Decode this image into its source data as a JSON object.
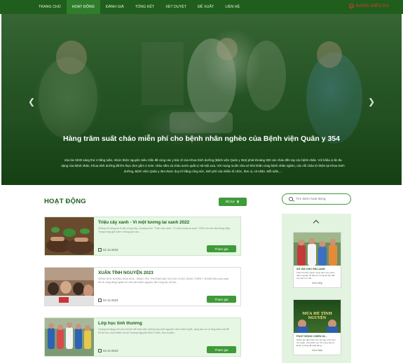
{
  "nav": {
    "items": [
      "TRANG CHỦ",
      "HOẠT ĐỘNG",
      "ĐÁNH GIÁ",
      "TỔNG KẾT",
      "XÉT DUYỆT",
      "ĐỀ XUẤT",
      "LIÊN HỆ"
    ],
    "active_index": 1,
    "live_label": "ĐANG DIỄN RA",
    "live_color": "#e0392b"
  },
  "hero": {
    "title": "Hàng trăm suất cháo miễn phí cho bệnh nhân nghèo của Bệnh viện Quân y 354",
    "description": "Vào lúc 5h30 sáng thứ 4 hằng tuần, nhóm thiện nguyện Siêu Gần đã cùng các y bác sĩ của Khoa Dinh dưỡng (Bệnh viện Quân y 354) phát khoảng 300 các cháo đến tay các bệnh nhân. Với khẩu vị ăn đa dạng của bệnh nhân, Khoa dinh dưỡng đã lên thực đơn gồm 2 món: cháo nấm và cháo sườn quất vị Hà Nội xưa. Với mong muốn chia sẻ khó khăn cùng bệnh nhân nghèo, các nồi cháo từ thiện tại Khoa Dinh dưỡng, Bệnh viện Quân y 354 được duy trì bằng công sức, kinh phí của nhiều tổ chức, đơn vị, cá nhân. Mỗi tuần,...",
    "prev_icon": "chevron-left-icon",
    "next_icon": "chevron-right-icon"
  },
  "section": {
    "title": "HOẠT ĐỘNG",
    "filter_label": "Bộ lọc",
    "filter_icon": "filter-icon"
  },
  "search": {
    "placeholder": "Tìm kiếm hoạt động"
  },
  "activities": [
    {
      "title": "Triệu cây xanh - Vì một tương lai xanh 2022",
      "excerpt": "Không chỉ dừng lại ở việc trồng cây, chương trình \"Triệu cây xanh - Vì một tương lai xanh\" 2022 còn lan tỏa thông điệp \"trồng rừng giữ nước\" thông qua các...",
      "date": "01-12-2023",
      "join_label": "Tham gia",
      "highlighted": true
    },
    {
      "title": "XUÂN TÌNH NGUYỆN 2023",
      "excerpt": "SỐNG NHƯ NHỮNG ĐÓA HOA - HĂNG YÊU THƯƠNG BAY XA CHO CUỘC SỐNG THÊM Ý NGHĨA Mỗi mùa xuân tết về cũng đồng nghĩa với việc làm thiện nguyện, Bộ Công tác Xã hội...",
      "date": "04-12-2023",
      "join_label": "Tham gia",
      "highlighted": false
    },
    {
      "title": "Lớp học tình thương",
      "excerpt": "Chúng tôi đang mở cửa trái tim để chào đón những bạn tình nguyện viên nhiệt huyết, sáng tạo và có lòng đam mê để hỗ trợ học sinh khiếm thị tại Trường Nguyễn Đình Chiểu. Đọc truyện...",
      "date": "04-12-2023",
      "join_label": "Tham gia",
      "highlighted": true
    }
  ],
  "sidebar": {
    "up_icon": "chevron-up-icon",
    "items": [
      {
        "title": "SỬ ÂM CHO EM LẠNH",
        "description": "Tiếp nối năm ngoái, trong năm nay nhóm thiện nguyện sẽ tiếp tục mang áo ấm đến cho các em nhỏ...",
        "more_label": "Xem tiếp"
      },
      {
        "title": "PHÁT ĐỘNG CHIẾN DỊ...",
        "banner_text": "MÙA HÈ TÌNH NGUYỆN",
        "description": "Nhằm tạo điều kiện cho các bạn sinh viên rèn luyện, cống hiến sức trẻ trong dịp hè, Đoàn trường đã phát động...",
        "more_label": "Xem tiếp"
      }
    ]
  }
}
